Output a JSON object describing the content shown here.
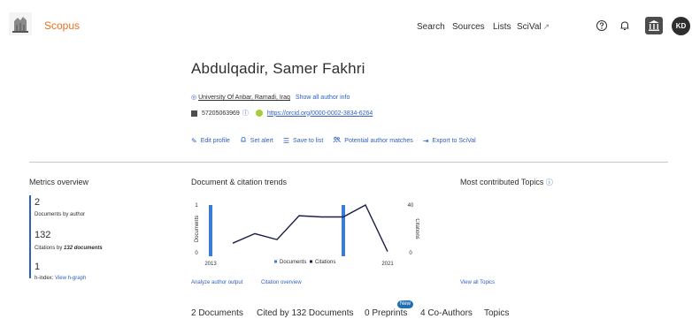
{
  "header": {
    "brand": "Scopus",
    "nav": [
      {
        "label": "Search"
      },
      {
        "label": "Sources"
      },
      {
        "label": "Lists"
      },
      {
        "label": "SciVal",
        "ext": "↗"
      }
    ],
    "avatar_initials": "KD"
  },
  "profile": {
    "name": "Abdulqadir, Samer Fakhri",
    "affiliation": "University Of Anbar, Ramadi, Iraq",
    "show_all_info": "Show all author info",
    "scopus_id": "57205063969",
    "orcid_url": "https://orcid.org/0000-0002-3834-6264",
    "actions": [
      {
        "icon": "pencil-icon",
        "glyph": "✎",
        "label": "Edit profile"
      },
      {
        "icon": "bell-icon",
        "glyph": "🔔",
        "label": "Set alert"
      },
      {
        "icon": "list-icon",
        "glyph": "☰",
        "label": "Save to list"
      },
      {
        "icon": "people-icon",
        "glyph": "👥",
        "label": "Potential author matches"
      },
      {
        "icon": "export-icon",
        "glyph": "⇥",
        "label": "Export to SciVal"
      }
    ]
  },
  "metrics": {
    "title": "Metrics overview",
    "documents_value": "2",
    "documents_label": "Documents by author",
    "citations_value": "132",
    "citations_label_prefix": "Citations by ",
    "citations_label_bold": "132 documents",
    "hindex_value": "1",
    "hindex_label": "h-index:",
    "view_hgraph": "View h-graph"
  },
  "trends": {
    "title": "Document & citation trends",
    "analyze_link": "Analyze author output",
    "citation_link": "Citation overview"
  },
  "topics": {
    "title": "Most contributed Topics",
    "view_all": "View all Topics"
  },
  "tabs": [
    {
      "label": "2 Documents"
    },
    {
      "label": "Cited by 132 Documents"
    },
    {
      "label": "0 Preprints"
    },
    {
      "label": "4 Co-Authors"
    },
    {
      "label": "Topics"
    }
  ],
  "new_badge": "New",
  "chart_data": {
    "type": "bar+line",
    "x_start_label": "2013",
    "x_end_label": "2021",
    "left_axis": {
      "label": "Documents",
      "ticks": [
        "1",
        "0"
      ],
      "range": [
        0,
        1
      ]
    },
    "right_axis": {
      "label": "Citations",
      "ticks": [
        "40",
        "0"
      ],
      "range": [
        0,
        40
      ]
    },
    "legend": [
      {
        "name": "Documents",
        "color": "#3a7bd5"
      },
      {
        "name": "Citations",
        "color": "#1b1f4a"
      }
    ],
    "documents": {
      "x": [
        2013,
        2019
      ],
      "values": [
        1,
        1
      ]
    },
    "citations": {
      "x": [
        2014,
        2015,
        2016,
        2017,
        2018,
        2019,
        2020,
        2021
      ],
      "values": [
        8,
        16,
        11,
        31,
        30,
        30,
        40,
        1
      ]
    }
  }
}
